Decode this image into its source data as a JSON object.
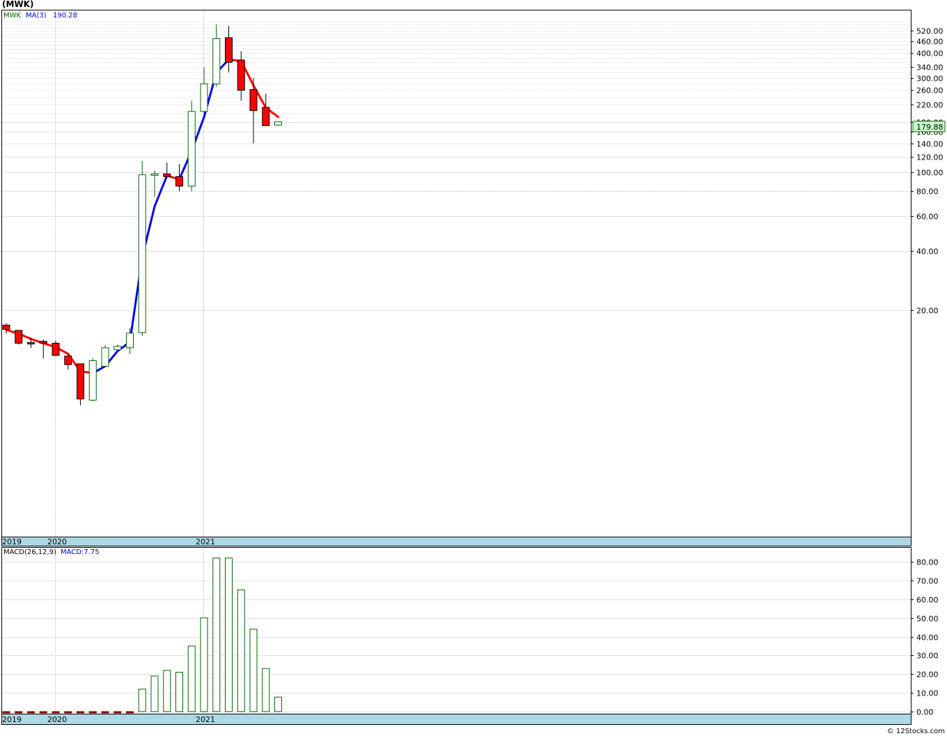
{
  "title": "(MWK)",
  "footer": "© 12Stocks.com",
  "colors": {
    "up": "#006400",
    "down": "#ff0000",
    "ma_up": "#0000ee",
    "ma_down": "#ff0000",
    "grid": "#c0c0c0",
    "dateband": "#add8e6",
    "pricelabel": "#ccffcc"
  },
  "chart_data": [
    {
      "type": "candlestick",
      "title": "",
      "legend": {
        "symbol": "MWK",
        "ma_label": "MA(3)",
        "ma_value": "190.28"
      },
      "yscale": "log",
      "yticks": [
        "20.00",
        "40.00",
        "60.00",
        "80.00",
        "100.00",
        "120.00",
        "140.00",
        "160.00",
        "180.00",
        "220.00",
        "260.00",
        "300.00",
        "340.00",
        "400.00",
        "460.00",
        "520.00"
      ],
      "ylim": [
        10,
        600
      ],
      "last_price": "179.88",
      "date_labels": [
        {
          "label": "2019",
          "index": 0
        },
        {
          "label": "2020",
          "index": 4
        },
        {
          "label": "2021",
          "index": 16
        }
      ],
      "candles": [
        {
          "o": 16.8,
          "h": 17.2,
          "l": 15.2,
          "c": 16.0
        },
        {
          "o": 15.8,
          "h": 15.8,
          "l": 13.4,
          "c": 13.6
        },
        {
          "o": 13.7,
          "h": 14.5,
          "l": 12.9,
          "c": 13.5
        },
        {
          "o": 13.9,
          "h": 14.2,
          "l": 11.4,
          "c": 13.6
        },
        {
          "o": 13.6,
          "h": 14.0,
          "l": 11.7,
          "c": 11.8
        },
        {
          "o": 11.7,
          "h": 12.0,
          "l": 10.0,
          "c": 10.6
        },
        {
          "o": 10.7,
          "h": 10.7,
          "l": 6.6,
          "c": 7.1
        },
        {
          "o": 7.0,
          "h": 11.4,
          "l": 6.9,
          "c": 11.1
        },
        {
          "o": 10.4,
          "h": 13.3,
          "l": 10.3,
          "c": 12.9
        },
        {
          "o": 12.6,
          "h": 13.4,
          "l": 12.3,
          "c": 13.1
        },
        {
          "o": 12.9,
          "h": 16.2,
          "l": 12.0,
          "c": 15.3
        },
        {
          "o": 15.4,
          "h": 114,
          "l": 14.8,
          "c": 97
        },
        {
          "o": 97,
          "h": 102,
          "l": 75,
          "c": 98
        },
        {
          "o": 98,
          "h": 112,
          "l": 93,
          "c": 95
        },
        {
          "o": 95,
          "h": 110,
          "l": 80,
          "c": 85
        },
        {
          "o": 85,
          "h": 230,
          "l": 80,
          "c": 203
        },
        {
          "o": 203,
          "h": 340,
          "l": 200,
          "c": 280
        },
        {
          "o": 280,
          "h": 560,
          "l": 270,
          "c": 475
        },
        {
          "o": 480,
          "h": 550,
          "l": 320,
          "c": 360
        },
        {
          "o": 370,
          "h": 410,
          "l": 230,
          "c": 260
        },
        {
          "o": 262,
          "h": 300,
          "l": 140,
          "c": 205
        },
        {
          "o": 213,
          "h": 250,
          "l": 172,
          "c": 172
        },
        {
          "o": 173,
          "h": 181,
          "l": 172,
          "c": 179.9
        }
      ],
      "ma": [
        {
          "i": 0,
          "v": 15.9
        },
        {
          "i": 1,
          "v": 15.2
        },
        {
          "i": 2,
          "v": 14.3
        },
        {
          "i": 3,
          "v": 13.6
        },
        {
          "i": 4,
          "v": 13.0
        },
        {
          "i": 5,
          "v": 12.0
        },
        {
          "i": 6,
          "v": 9.8
        },
        {
          "i": 7,
          "v": 9.6
        },
        {
          "i": 8,
          "v": 10.4
        },
        {
          "i": 9,
          "v": 12.4
        },
        {
          "i": 10,
          "v": 13.8
        },
        {
          "i": 11,
          "v": 37
        },
        {
          "i": 12,
          "v": 67
        },
        {
          "i": 13,
          "v": 96
        },
        {
          "i": 14,
          "v": 92
        },
        {
          "i": 15,
          "v": 128
        },
        {
          "i": 16,
          "v": 190
        },
        {
          "i": 17,
          "v": 319
        },
        {
          "i": 18,
          "v": 372
        },
        {
          "i": 19,
          "v": 365
        },
        {
          "i": 20,
          "v": 275
        },
        {
          "i": 21,
          "v": 212
        },
        {
          "i": 22,
          "v": 190.28
        }
      ]
    },
    {
      "type": "bar",
      "title": "",
      "legend": {
        "label": "MACD(26,12,9)",
        "value_label": "MACD:7.75"
      },
      "yticks": [
        "0.00",
        "10.00",
        "20.00",
        "30.00",
        "40.00",
        "50.00",
        "60.00",
        "70.00",
        "80.00"
      ],
      "ylim": [
        -1,
        85
      ],
      "values": [
        -0.4,
        -0.4,
        -0.4,
        -0.4,
        -0.4,
        -0.4,
        -0.5,
        -0.5,
        -0.5,
        -0.5,
        -0.3,
        12,
        19,
        22,
        21,
        35,
        50,
        82,
        82,
        65,
        44,
        23,
        7.75
      ]
    }
  ]
}
